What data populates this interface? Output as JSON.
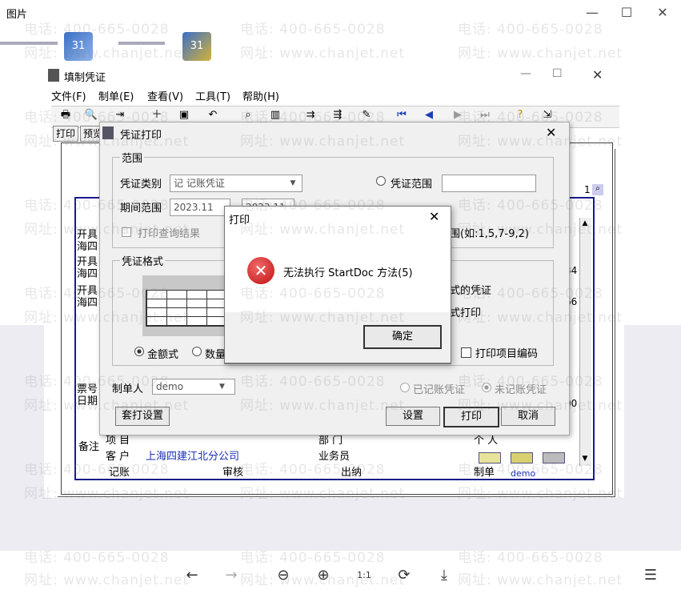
{
  "viewer": {
    "title": "图片",
    "minimize_icon": "minimize-icon",
    "maximize_icon": "maximize-icon",
    "close_icon": "close-icon"
  },
  "app": {
    "title": "填制凭证",
    "menu": [
      "文件(F)",
      "制单(E)",
      "查看(V)",
      "工具(T)",
      "帮助(H)"
    ],
    "toolbar_buttons": [
      "打印",
      "预览"
    ]
  },
  "voucher": {
    "left_labels": [
      "开具\n海四",
      "开具\n海四",
      "开具\n海四",
      "票号\n日期",
      "备注"
    ],
    "right_numbers": [
      "34",
      "66",
      "00"
    ],
    "page_number": "1",
    "footer_row1": {
      "item": "项  目",
      "dept": "部  门",
      "person": "个  人"
    },
    "footer_row2": {
      "customer_label": "客  户",
      "customer_value": "上海四建江北分公司",
      "salesman": "业务员"
    },
    "signatures": {
      "bookkeeping": "记账",
      "review": "审核",
      "cashier": "出纳",
      "maker_label": "制单",
      "maker_value": "demo"
    }
  },
  "print_dialog": {
    "title": "凭证打印",
    "range_group": "范围",
    "voucher_type_label": "凭证类别",
    "voucher_type_value": "记    记账凭证",
    "period_label": "期间范围",
    "period_from": "2023.11",
    "period_to": "2023.11",
    "voucher_range_label": "凭证范围",
    "print_query_result": "打印查询结果",
    "range_hint": "围(如:1,5,7-9,2)",
    "format_group": "凭证格式",
    "format_amount": "金额式",
    "format_qty": "数量",
    "right_hint1": "式的凭证",
    "right_hint2": "式打印",
    "print_item_code": "打印项目编码",
    "maker_label": "制单人",
    "maker_value": "demo",
    "posted": "已记账凭证",
    "unposted": "未记账凭证",
    "btn_tailor": "套打设置",
    "btn_settings": "设置",
    "btn_print": "打印",
    "btn_cancel": "取消"
  },
  "error_dialog": {
    "title": "打印",
    "message": "无法执行 StartDoc 方法(5)",
    "ok": "确定"
  },
  "watermark": {
    "phone": "电话: 400-665-0028",
    "site": "网址: www.chanjet.net"
  },
  "bottom_toolbar": [
    "back-arrow-icon",
    "forward-arrow-icon",
    "zoom-out-icon",
    "zoom-in-icon",
    "actual-size-icon",
    "rotate-icon",
    "download-icon",
    "ocr-text-icon"
  ]
}
